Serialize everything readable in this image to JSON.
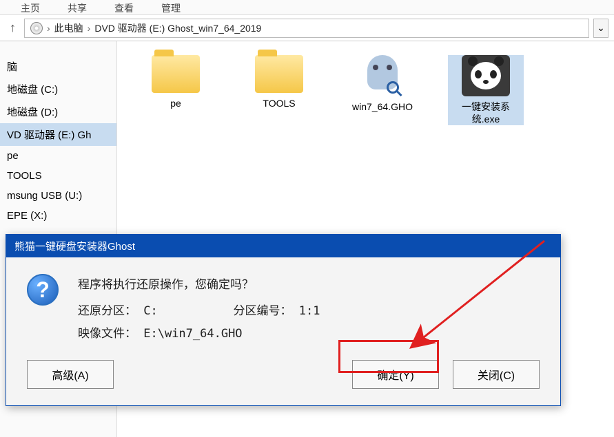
{
  "menubar": {
    "item1": "主页",
    "item2": "共享",
    "item3": "查看",
    "item4": "管理"
  },
  "breadcrumb": {
    "root": "此电脑",
    "drive": "DVD 驱动器 (E:) Ghost_win7_64_2019"
  },
  "sidebar": {
    "items": [
      "脑",
      "地磁盘 (C:)",
      "地磁盘 (D:)",
      "VD 驱动器 (E:) Gh",
      "pe",
      "TOOLS",
      "msung USB (U:)",
      "EPE (X:)"
    ]
  },
  "files": [
    {
      "name": "pe",
      "type": "folder"
    },
    {
      "name": "TOOLS",
      "type": "folder"
    },
    {
      "name": "win7_64.GHO",
      "type": "gho"
    },
    {
      "name": "一键安装系统.exe",
      "type": "panda"
    }
  ],
  "dialog": {
    "title": "熊猫一键硬盘安装器Ghost",
    "message": "程序将执行还原操作，您确定吗？",
    "partition_label": "还原分区：",
    "partition_value": "C:",
    "partnum_label": "分区编号：",
    "partnum_value": "1:1",
    "image_label": "映像文件：",
    "image_value": "E:\\win7_64.GHO",
    "btn_advanced": "高级(A)",
    "btn_ok": "确定(Y)",
    "btn_close": "关闭(C)"
  }
}
